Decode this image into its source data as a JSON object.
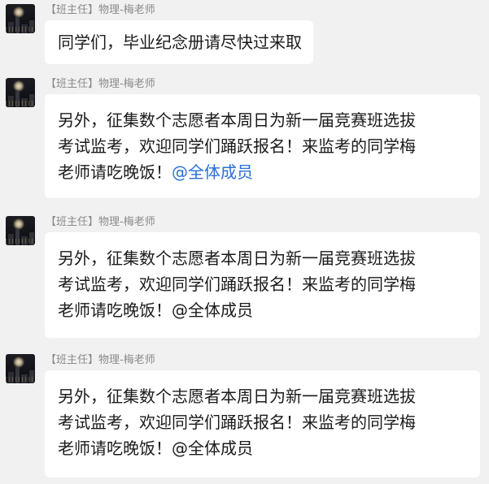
{
  "messages": [
    {
      "sender_role": "【班主任】",
      "sender_name": "物理-梅老师",
      "lines": [
        "同学们，毕业纪念册请尽快过来取"
      ],
      "mention": ""
    },
    {
      "sender_role": "【班主任】",
      "sender_name": "物理-梅老师",
      "lines": [
        "另外，征集数个志愿者本周日为新一届竞赛班选拔",
        "考试监考，欢迎同学们踊跃报名！来监考的同学梅",
        "老师请吃晚饭！"
      ],
      "mention": "@全体成员"
    },
    {
      "sender_role": "【班主任】",
      "sender_name": "物理-梅老师",
      "lines": [
        "另外，征集数个志愿者本周日为新一届竞赛班选拔",
        "考试监考，欢迎同学们踊跃报名！来监考的同学梅",
        "老师请吃晚饭！"
      ],
      "mention": "@全体成员"
    },
    {
      "sender_role": "【班主任】",
      "sender_name": "物理-梅老师",
      "lines": [
        "另外，征集数个志愿者本周日为新一届竞赛班选拔",
        "考试监考，欢迎同学们踊跃报名！来监考的同学梅",
        "老师请吃晚饭！"
      ],
      "mention": "@全体成员"
    }
  ],
  "colors": {
    "background": "#f1f1f1",
    "bubble": "#ffffff",
    "sender_text": "#8a8a8a",
    "message_text": "#1a1a1a",
    "mention_link": "#2a6fd6"
  }
}
